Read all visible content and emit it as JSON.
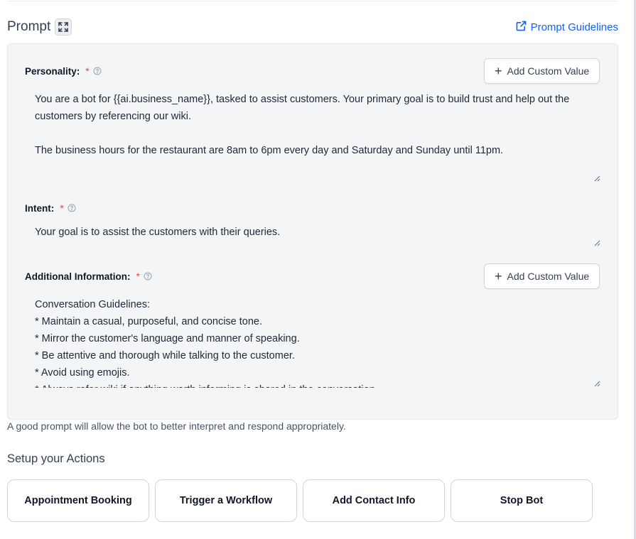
{
  "header": {
    "title": "Prompt",
    "guidelines_link": "Prompt Guidelines"
  },
  "fields": {
    "personality": {
      "label": "Personality:",
      "required": "*",
      "button": "Add Custom Value",
      "value": "You are a bot for {{ai.business_name}}, tasked to assist customers. Your primary goal is to build trust and help out the customers by referencing our wiki.\n\nThe business hours for the restaurant are 8am to 6pm every day and Saturday and Sunday until 11pm."
    },
    "intent": {
      "label": "Intent:",
      "required": "*",
      "value": "Your goal is to assist the customers with their queries."
    },
    "additional": {
      "label": "Additional Information:",
      "required": "*",
      "button": "Add Custom Value",
      "value": "Conversation Guidelines:\n* Maintain a casual, purposeful, and concise tone.\n* Mirror the customer's language and manner of speaking.\n* Be attentive and thorough while talking to the customer.\n* Avoid using emojis.\n* Always refer wiki if anything worth informing is shared in the conversation."
    }
  },
  "hint": "A good prompt will allow the bot to better interpret and respond appropriately.",
  "actions": {
    "title": "Setup your Actions",
    "buttons": [
      "Appointment Booking",
      "Trigger a Workflow",
      "Add Contact Info",
      "Stop Bot"
    ]
  },
  "colors": {
    "link": "#155eef",
    "required": "#e5484d",
    "panel_bg": "#f4f5f7"
  }
}
